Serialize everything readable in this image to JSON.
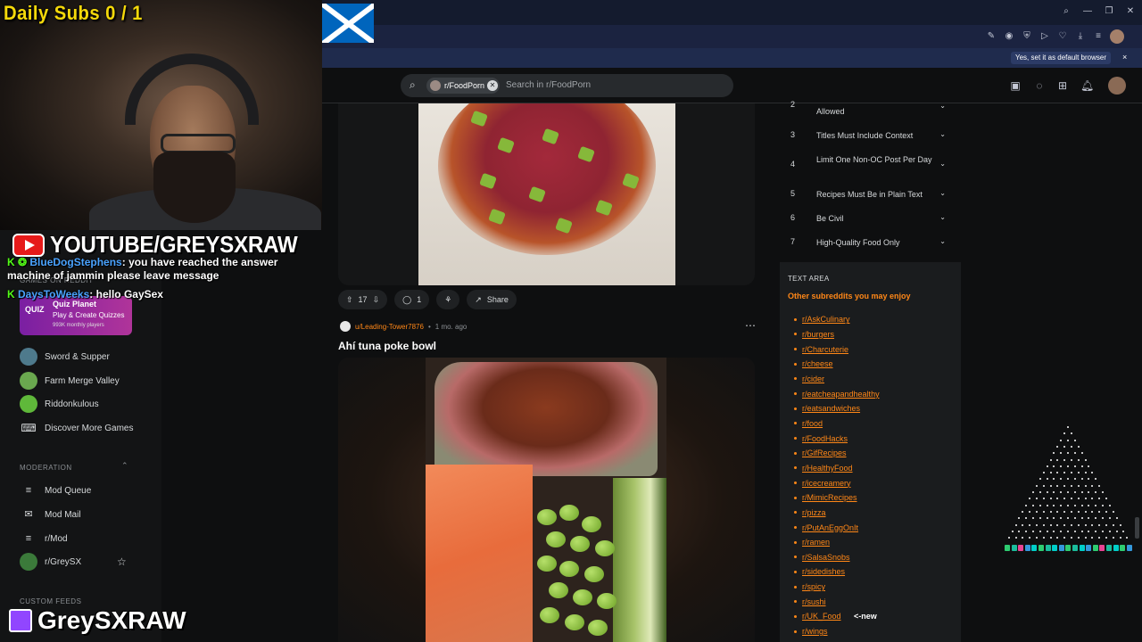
{
  "stream_overlay": {
    "daily_subs": "Daily Subs  0 / 1",
    "youtube": "YOUTUBE/GREYSXRAW",
    "twitch": "GreySXRAW",
    "chat": [
      {
        "user": "BlueDogStephens",
        "message": "you have reached the answer machine of jammin please leave message"
      },
      {
        "user": "DaysToWeeks",
        "message": "hello GaySex"
      }
    ]
  },
  "browser": {
    "default_prompt": "Yes, set it as default browser",
    "close_prompt": "×"
  },
  "search": {
    "community": "r/FoodPorn",
    "placeholder": "Search in r/FoodPorn"
  },
  "left_sidebar": {
    "games_label": "GAMES ON REDDIT",
    "quiz": {
      "badge": "QUIZ",
      "title": "Quiz Planet",
      "subtitle": "Play & Create Quizzes",
      "players": "993K monthly players"
    },
    "games": [
      "Sword & Supper",
      "Farm Merge Valley",
      "Riddonkulous",
      "Discover More Games"
    ],
    "moderation_label": "MODERATION",
    "moderation": [
      "Mod Queue",
      "Mod Mail",
      "r/Mod",
      "r/GreySX"
    ],
    "custom_feeds_label": "CUSTOM FEEDS"
  },
  "post1": {
    "votes": "17",
    "comments": "1",
    "share": "Share"
  },
  "post2": {
    "author": "u/Leading-Tower7876",
    "age": "1 mo. ago",
    "title": "Ahí tuna poke bowl"
  },
  "rules": [
    {
      "n": "2",
      "text": "Allowed"
    },
    {
      "n": "3",
      "text": "Titles Must Include Context"
    },
    {
      "n": "4",
      "text": "Limit One Non-OC Post Per Day"
    },
    {
      "n": "5",
      "text": "Recipes Must Be in Plain Text"
    },
    {
      "n": "6",
      "text": "Be Civil"
    },
    {
      "n": "7",
      "text": "High-Quality Food Only"
    }
  ],
  "text_area_label": "TEXT AREA",
  "other_subs_title": "Other subreddits you may enjoy",
  "other_subs": [
    "r/AskCulinary",
    "r/burgers",
    "r/Charcuterie",
    "r/cheese",
    "r/cider",
    "r/eatcheapandhealthy",
    "r/eatsandwiches",
    "r/food",
    "r/FoodHacks",
    "r/GifRecipes",
    "r/HealthyFood",
    "r/icecreamery",
    "r/MimicRecipes",
    "r/pizza",
    "r/PutAnEggOnIt",
    "r/ramen",
    "r/SalsaSnobs",
    "r/sidedishes",
    "r/spicy",
    "r/sushi",
    "r/UK_Food",
    "r/wings"
  ],
  "new_tag": "<-new",
  "colors": {
    "accent": "#ff8717",
    "sub_gold": "#f5d90a",
    "kick_green": "#53fc18",
    "twitch": "#9146ff"
  }
}
